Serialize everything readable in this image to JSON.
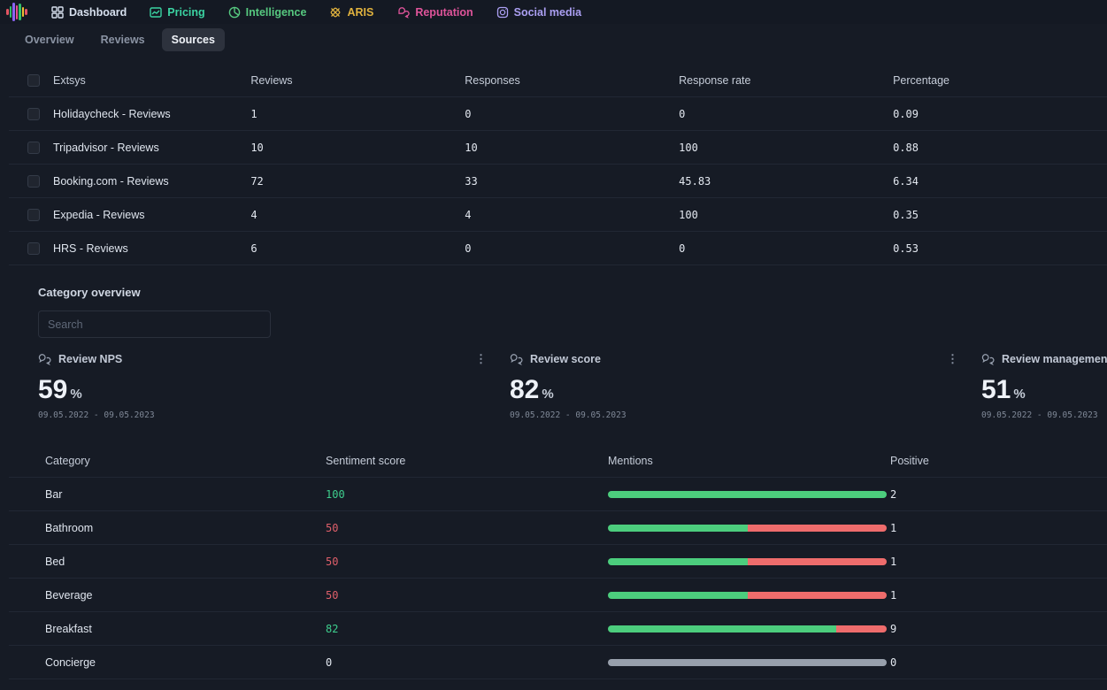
{
  "nav": {
    "items": [
      {
        "label": "Dashboard",
        "icon": "grid-icon"
      },
      {
        "label": "Pricing",
        "icon": "line-chart-icon"
      },
      {
        "label": "Intelligence",
        "icon": "pie-chart-icon"
      },
      {
        "label": "ARIS",
        "icon": "knot-icon"
      },
      {
        "label": "Reputation",
        "icon": "chat-bubbles-icon"
      },
      {
        "label": "Social media",
        "icon": "camera-icon"
      }
    ]
  },
  "tabs": {
    "items": [
      "Overview",
      "Reviews",
      "Sources"
    ],
    "active": "Sources"
  },
  "sources_table": {
    "columns": [
      "Extsys",
      "Reviews",
      "Responses",
      "Response rate",
      "Percentage"
    ],
    "rows": [
      {
        "name": "Holidaycheck - Reviews",
        "reviews": "1",
        "responses": "0",
        "response_rate": "0",
        "percentage": "0.09"
      },
      {
        "name": "Tripadvisor - Reviews",
        "reviews": "10",
        "responses": "10",
        "response_rate": "100",
        "percentage": "0.88"
      },
      {
        "name": "Booking.com - Reviews",
        "reviews": "72",
        "responses": "33",
        "response_rate": "45.83",
        "percentage": "6.34"
      },
      {
        "name": "Expedia - Reviews",
        "reviews": "4",
        "responses": "4",
        "response_rate": "100",
        "percentage": "0.35"
      },
      {
        "name": "HRS - Reviews",
        "reviews": "6",
        "responses": "0",
        "response_rate": "0",
        "percentage": "0.53"
      }
    ]
  },
  "category_section": {
    "title": "Category overview",
    "search_placeholder": "Search"
  },
  "cards": [
    {
      "title": "Review NPS",
      "value": "59",
      "unit": "%",
      "date_range": "09.05.2022 - 09.05.2023"
    },
    {
      "title": "Review score",
      "value": "82",
      "unit": "%",
      "date_range": "09.05.2022 - 09.05.2023"
    },
    {
      "title": "Review management",
      "value": "51",
      "unit": "%",
      "date_range": "09.05.2022 - 09.05.2023"
    }
  ],
  "category_table": {
    "columns": [
      "Category",
      "Sentiment score",
      "Mentions",
      "Positive"
    ],
    "rows": [
      {
        "category": "Bar",
        "sentiment_score": "100",
        "score_color": "green",
        "positive": "2",
        "bar": {
          "green": 100,
          "red": 0,
          "neutral": false
        }
      },
      {
        "category": "Bathroom",
        "sentiment_score": "50",
        "score_color": "red",
        "positive": "1",
        "bar": {
          "green": 50,
          "red": 50,
          "neutral": false
        }
      },
      {
        "category": "Bed",
        "sentiment_score": "50",
        "score_color": "red",
        "positive": "1",
        "bar": {
          "green": 50,
          "red": 50,
          "neutral": false
        }
      },
      {
        "category": "Beverage",
        "sentiment_score": "50",
        "score_color": "red",
        "positive": "1",
        "bar": {
          "green": 50,
          "red": 50,
          "neutral": false
        }
      },
      {
        "category": "Breakfast",
        "sentiment_score": "82",
        "score_color": "green",
        "positive": "9",
        "bar": {
          "green": 82,
          "red": 18,
          "neutral": false
        }
      },
      {
        "category": "Concierge",
        "sentiment_score": "0",
        "score_color": "plain",
        "positive": "0",
        "bar": {
          "green": 0,
          "red": 0,
          "neutral": true
        }
      }
    ]
  },
  "colors": {
    "positive_green_text": "#3ecf8e",
    "negative_red_text": "#df5f6a",
    "plain_text": "#e3e8f0",
    "bar_green": "#4ccd7d",
    "bar_red": "#ee6c6c",
    "bar_neutral": "#98a0ac",
    "nav_pricing": "#3bd3a2",
    "nav_intelligence": "#56c87f",
    "nav_aris": "#e0b23e",
    "nav_reputation": "#df549a",
    "nav_social": "#ab9ff2"
  },
  "kebab_glyph": "⋮"
}
